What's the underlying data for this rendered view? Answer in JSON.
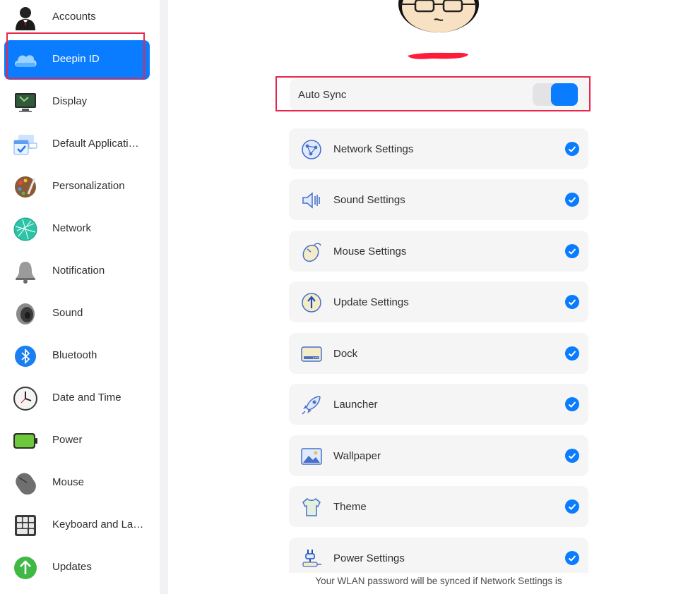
{
  "sidebar": {
    "items": [
      {
        "label": "Accounts",
        "icon": "accounts-icon"
      },
      {
        "label": "Deepin ID",
        "icon": "cloud-icon",
        "active": true
      },
      {
        "label": "Display",
        "icon": "display-icon"
      },
      {
        "label": "Default Applicati…",
        "icon": "default-apps-icon"
      },
      {
        "label": "Personalization",
        "icon": "palette-icon"
      },
      {
        "label": "Network",
        "icon": "network-globe-icon"
      },
      {
        "label": "Notification",
        "icon": "bell-icon"
      },
      {
        "label": "Sound",
        "icon": "speaker-icon"
      },
      {
        "label": "Bluetooth",
        "icon": "bluetooth-icon"
      },
      {
        "label": "Date and Time",
        "icon": "clock-icon"
      },
      {
        "label": "Power",
        "icon": "battery-icon"
      },
      {
        "label": "Mouse",
        "icon": "mouse-icon"
      },
      {
        "label": "Keyboard and La…",
        "icon": "keyboard-icon"
      },
      {
        "label": "Updates",
        "icon": "update-arrow-icon"
      }
    ]
  },
  "sync": {
    "label": "Auto Sync",
    "enabled": true
  },
  "settings": [
    {
      "label": "Network Settings",
      "icon": "network-settings-icon",
      "checked": true
    },
    {
      "label": "Sound Settings",
      "icon": "sound-settings-icon",
      "checked": true
    },
    {
      "label": "Mouse Settings",
      "icon": "mouse-settings-icon",
      "checked": true
    },
    {
      "label": "Update Settings",
      "icon": "update-settings-icon",
      "checked": true
    },
    {
      "label": "Dock",
      "icon": "dock-icon",
      "checked": true
    },
    {
      "label": "Launcher",
      "icon": "rocket-icon",
      "checked": true
    },
    {
      "label": "Wallpaper",
      "icon": "wallpaper-icon",
      "checked": true
    },
    {
      "label": "Theme",
      "icon": "shirt-icon",
      "checked": true
    },
    {
      "label": "Power Settings",
      "icon": "power-plug-icon",
      "checked": true
    }
  ],
  "footer": {
    "note": "Your WLAN password will be synced if Network Settings is"
  },
  "colors": {
    "accent": "#0a7cff",
    "highlight": "#e8264c",
    "row_bg": "#f5f5f6"
  }
}
